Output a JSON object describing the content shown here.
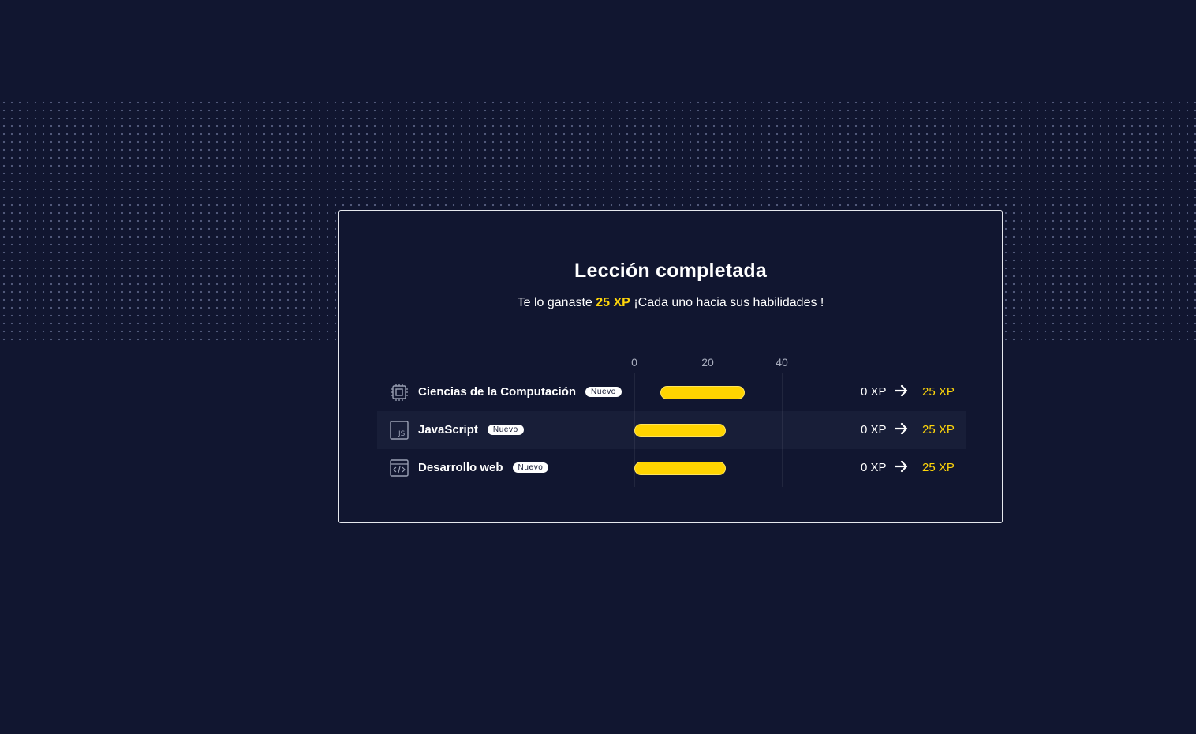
{
  "modal": {
    "title": "Lección completada",
    "subtitle_before": "Te lo ganaste",
    "subtitle_xp": "25 XP",
    "subtitle_after": "¡Cada uno hacia sus habilidades !"
  },
  "chart_data": {
    "type": "bar",
    "orientation": "horizontal",
    "x_ticks": [
      "0",
      "20",
      "40"
    ],
    "categories": [
      "Ciencias de la Computación",
      "JavaScript",
      "Desarrollo web"
    ],
    "series": [
      {
        "values": [
          25,
          25,
          25
        ]
      }
    ],
    "xlim": [
      0,
      40
    ],
    "grid": true
  },
  "skills": [
    {
      "name": "Ciencias de la Computación",
      "badge": "Nuevo",
      "xp_before": "0 XP",
      "xp_after": "25 XP",
      "icon": "cpu-icon"
    },
    {
      "name": "JavaScript",
      "badge": "Nuevo",
      "xp_before": "0 XP",
      "xp_after": "25 XP",
      "icon": "javascript-icon"
    },
    {
      "name": "Desarrollo web",
      "badge": "Nuevo",
      "xp_before": "0 XP",
      "xp_after": "25 XP",
      "icon": "code-window-icon"
    }
  ],
  "colors": {
    "background": "#111630",
    "accent": "#ffd60a",
    "bar": "#ffd400",
    "row_highlight": "#181e38"
  }
}
